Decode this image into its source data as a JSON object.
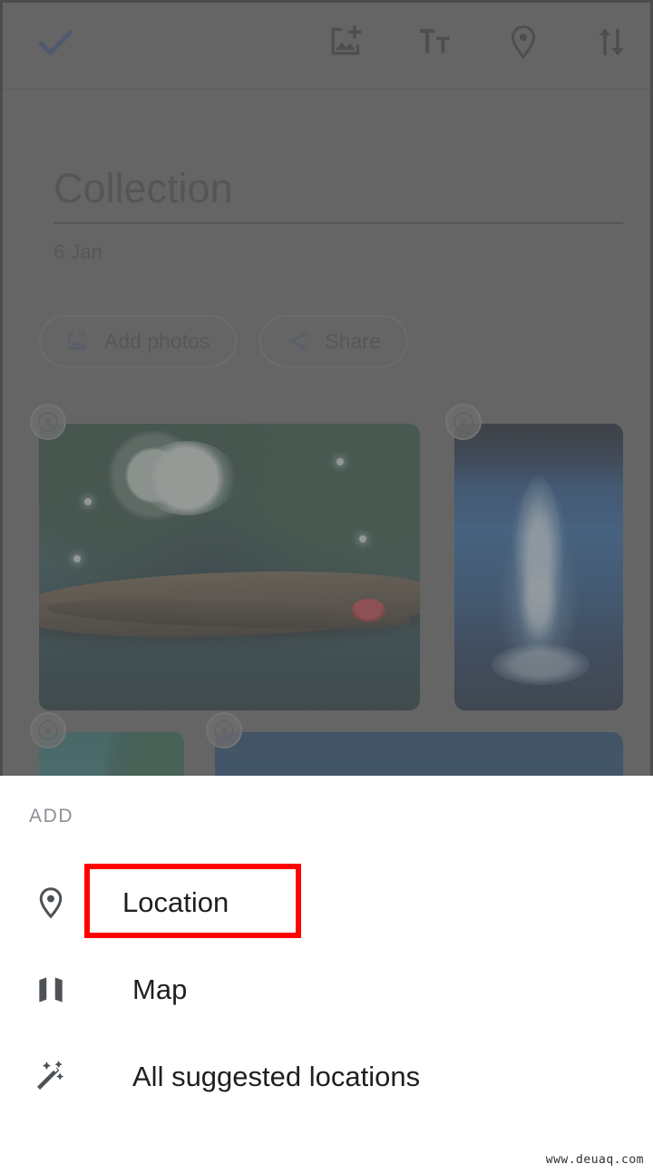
{
  "appbar": {
    "confirm_label": "check-done",
    "actions": [
      {
        "name": "add-photo-icon",
        "label": "Add photo"
      },
      {
        "name": "add-text-icon",
        "label": "Add text"
      },
      {
        "name": "add-location-icon",
        "label": "Add location"
      },
      {
        "name": "sort-icon",
        "label": "Sort"
      }
    ]
  },
  "album": {
    "title": "Collection",
    "date": "6 Jan",
    "chips": [
      {
        "label": "Add photos",
        "icon": "add-photo-icon"
      },
      {
        "label": "Share",
        "icon": "share-icon"
      }
    ]
  },
  "photos": [
    {
      "alt": "Moonlit forest with fallen log over water",
      "remove_label": "Remove"
    },
    {
      "alt": "Blue water fountain at night",
      "remove_label": "Remove"
    },
    {
      "alt": "Teal icy landscape",
      "remove_label": "Remove"
    },
    {
      "alt": "Deep blue underwater scene",
      "remove_label": "Remove"
    }
  ],
  "sheet": {
    "header": "ADD",
    "items": [
      {
        "label": "Location",
        "icon": "location-pin-icon",
        "highlighted": true
      },
      {
        "label": "Map",
        "icon": "map-icon",
        "highlighted": false
      },
      {
        "label": "All suggested locations",
        "icon": "magic-wand-icon",
        "highlighted": false
      }
    ]
  },
  "colors": {
    "highlight": "#ff0000",
    "accent": "#2d4a7c",
    "scrim": "#666666",
    "sheet_bg": "#ffffff",
    "icon": "#4e5256"
  },
  "watermark": "www.deuaq.com"
}
